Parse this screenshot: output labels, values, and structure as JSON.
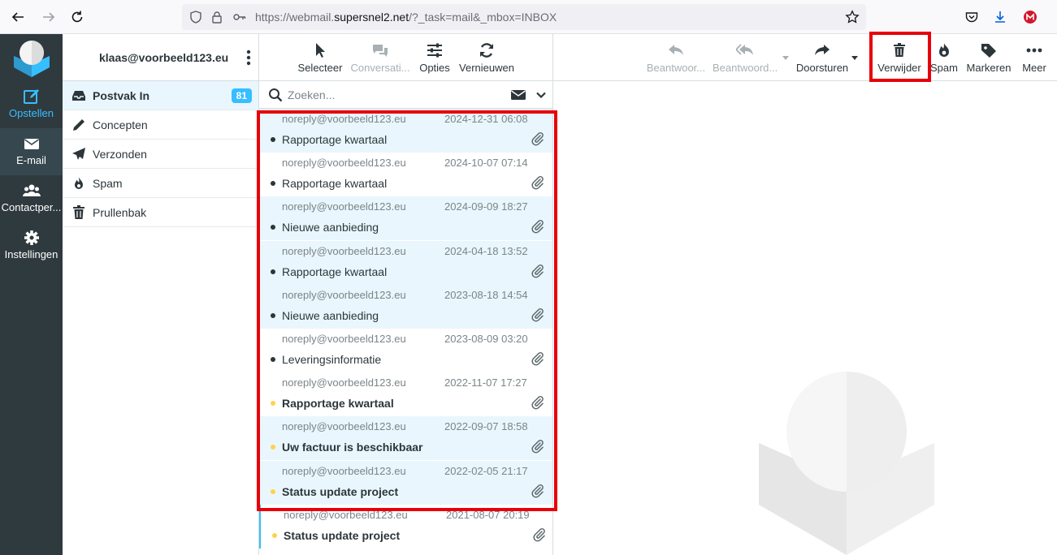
{
  "browser": {
    "url_prefix": "https://webmail.",
    "url_host": "supersnel2.net",
    "url_path": "/?_task=mail&_mbox=INBOX"
  },
  "rail": {
    "compose": "Opstellen",
    "mail": "E-mail",
    "contacts": "Contactper...",
    "settings": "Instellingen"
  },
  "account": {
    "email": "klaas@voorbeeld123.eu"
  },
  "folders": [
    {
      "label": "Postvak In",
      "count": "81",
      "icon": "inbox-icon"
    },
    {
      "label": "Concepten",
      "icon": "pencil-icon"
    },
    {
      "label": "Verzonden",
      "icon": "paper-plane-icon"
    },
    {
      "label": "Spam",
      "icon": "fire-icon"
    },
    {
      "label": "Prullenbak",
      "icon": "trash-icon"
    }
  ],
  "list_toolbar": {
    "select": "Selecteer",
    "threads": "Conversati...",
    "options": "Opties",
    "refresh": "Vernieuwen"
  },
  "search": {
    "placeholder": "Zoeken..."
  },
  "messages": [
    {
      "from": "noreply@voorbeeld123.eu",
      "date": "2024-12-31 06:08",
      "subject": "Rapportage kwartaal",
      "unread": false,
      "selected": true
    },
    {
      "from": "noreply@voorbeeld123.eu",
      "date": "2024-10-07 07:14",
      "subject": "Rapportage kwartaal",
      "unread": false,
      "selected": false
    },
    {
      "from": "noreply@voorbeeld123.eu",
      "date": "2024-09-09 18:27",
      "subject": "Nieuwe aanbieding",
      "unread": false,
      "selected": true
    },
    {
      "from": "noreply@voorbeeld123.eu",
      "date": "2024-04-18 13:52",
      "subject": "Rapportage kwartaal",
      "unread": false,
      "selected": true
    },
    {
      "from": "noreply@voorbeeld123.eu",
      "date": "2023-08-18 14:54",
      "subject": "Nieuwe aanbieding",
      "unread": false,
      "selected": true
    },
    {
      "from": "noreply@voorbeeld123.eu",
      "date": "2023-08-09 03:20",
      "subject": "Leveringsinformatie",
      "unread": false,
      "selected": false
    },
    {
      "from": "noreply@voorbeeld123.eu",
      "date": "2022-11-07 17:27",
      "subject": "Rapportage kwartaal",
      "unread": true,
      "selected": false
    },
    {
      "from": "noreply@voorbeeld123.eu",
      "date": "2022-09-07 18:58",
      "subject": "Uw factuur is beschikbaar",
      "unread": true,
      "selected": true
    },
    {
      "from": "noreply@voorbeeld123.eu",
      "date": "2022-02-05 21:17",
      "subject": "Status update project",
      "unread": true,
      "selected": true
    },
    {
      "from": "noreply@voorbeeld123.eu",
      "date": "2021-08-07 20:19",
      "subject": "Status update project",
      "unread": true,
      "selected": false
    }
  ],
  "mail_toolbar": {
    "reply": "Beantwoor...",
    "reply_all": "Beantwoord...",
    "forward": "Doorsturen",
    "delete": "Verwijder",
    "spam": "Spam",
    "mark": "Markeren",
    "more": "Meer"
  },
  "colors": {
    "accent": "#37beff",
    "rail_bg": "#2f3a3f",
    "highlight_border": "#e8000b",
    "unread_dot": "#ffd24d"
  }
}
